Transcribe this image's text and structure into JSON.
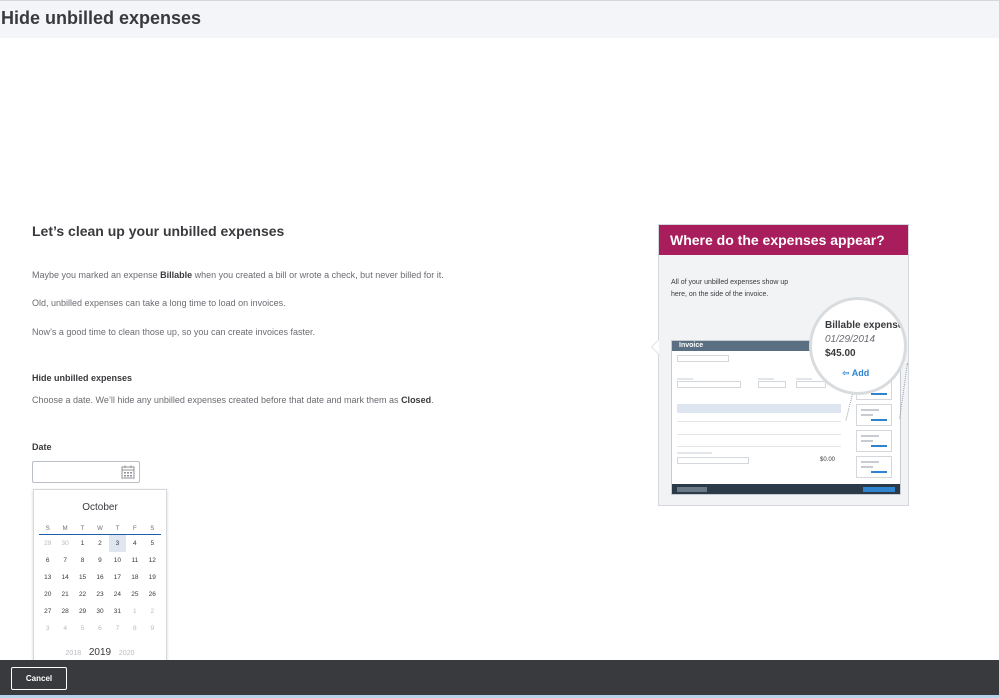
{
  "header": {
    "title": "Hide unbilled expenses"
  },
  "main": {
    "heading": "Let’s clean up your unbilled expenses",
    "paragraph1_pre": "Maybe you marked an expense ",
    "paragraph1_bold": "Billable",
    "paragraph1_post": " when you created a bill or wrote a check, but never billed for it.",
    "paragraph2": "Old, unbilled expenses can take a long time to load on invoices.",
    "paragraph3": "Now’s a good time to clean those up, so you can create invoices faster.",
    "subheading": "Hide unbilled expenses",
    "instruction_pre": "Choose a date. We’ll hide any unbilled expenses created before that date and mark them as ",
    "instruction_bold": "Closed",
    "instruction_post": ".",
    "date_label": "Date",
    "date_value": ""
  },
  "calendar": {
    "month": "October",
    "weekdays": [
      "S",
      "M",
      "T",
      "W",
      "T",
      "F",
      "S"
    ],
    "weeks": [
      [
        "29",
        "30",
        "1",
        "2",
        "3",
        "4",
        "5"
      ],
      [
        "6",
        "7",
        "8",
        "9",
        "10",
        "11",
        "12"
      ],
      [
        "13",
        "14",
        "15",
        "16",
        "17",
        "18",
        "19"
      ],
      [
        "20",
        "21",
        "22",
        "23",
        "24",
        "25",
        "26"
      ],
      [
        "27",
        "28",
        "29",
        "30",
        "31",
        "1",
        "2"
      ],
      [
        "3",
        "4",
        "5",
        "6",
        "7",
        "8",
        "9"
      ]
    ],
    "highlighted_day": "3",
    "prev_year": "2018",
    "current_year": "2019",
    "next_year": "2020"
  },
  "promo": {
    "title": "Where do the expenses appear?",
    "description": "All of your unbilled expenses show up here, on the side of the invoice.",
    "invoice_label": "Invoice",
    "invoice_total": "$0.00",
    "magnifier_title": "Billable expense",
    "magnifier_date": "01/29/2014",
    "magnifier_amount": "$45.00",
    "magnifier_add": "Add",
    "accent_color": "#a81e5c"
  },
  "footer": {
    "cancel_label": "Cancel"
  }
}
